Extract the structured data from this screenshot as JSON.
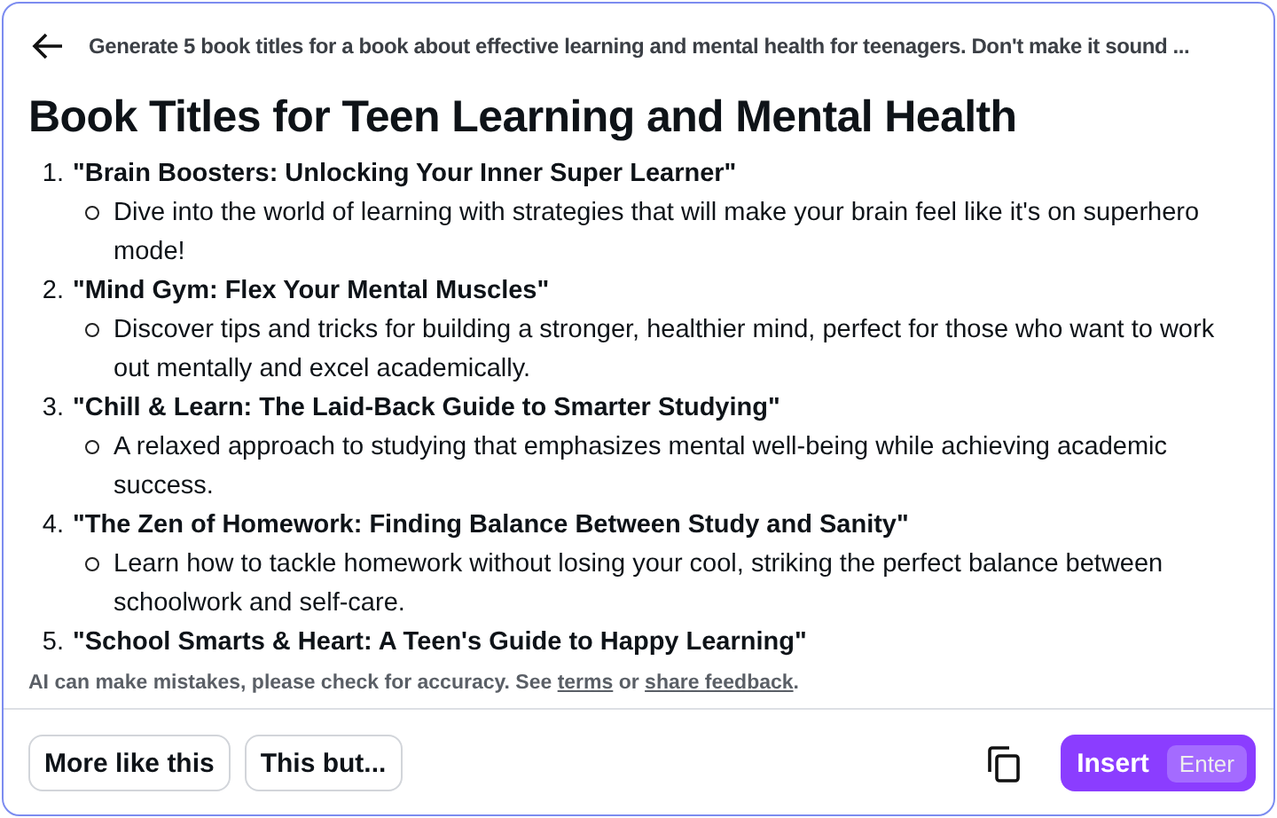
{
  "header": {
    "prompt": "Generate 5 book titles for a book about effective learning and mental health for teenagers. Don't make it sound ..."
  },
  "title": "Book Titles for Teen Learning and Mental Health",
  "items": [
    {
      "number": "1.",
      "title": "\"Brain Boosters: Unlocking Your Inner Super Learner\"",
      "description": "Dive into the world of learning with strategies that will make your brain feel like it's on superhero mode!"
    },
    {
      "number": "2.",
      "title": "\"Mind Gym: Flex Your Mental Muscles\"",
      "description": "Discover tips and tricks for building a stronger, healthier mind, perfect for those who want to work out mentally and excel academically."
    },
    {
      "number": "3.",
      "title": "\"Chill & Learn: The Laid-Back Guide to Smarter Studying\"",
      "description": "A relaxed approach to studying that emphasizes mental well-being while achieving academic success."
    },
    {
      "number": "4.",
      "title": "\"The Zen of Homework: Finding Balance Between Study and Sanity\"",
      "description": "Learn how to tackle homework without losing your cool, striking the perfect balance between schoolwork and self-care."
    },
    {
      "number": "5.",
      "title": "\"School Smarts & Heart: A Teen's Guide to Happy Learning\""
    }
  ],
  "disclaimer": {
    "before": "AI can make mistakes, please check for accuracy. See",
    "link1": "terms",
    "middle": "or",
    "link2": "share feedback",
    "after": "."
  },
  "buttons": [
    "More like this",
    "This but..."
  ],
  "insert": {
    "label": "Insert",
    "shortcut": "Enter"
  }
}
